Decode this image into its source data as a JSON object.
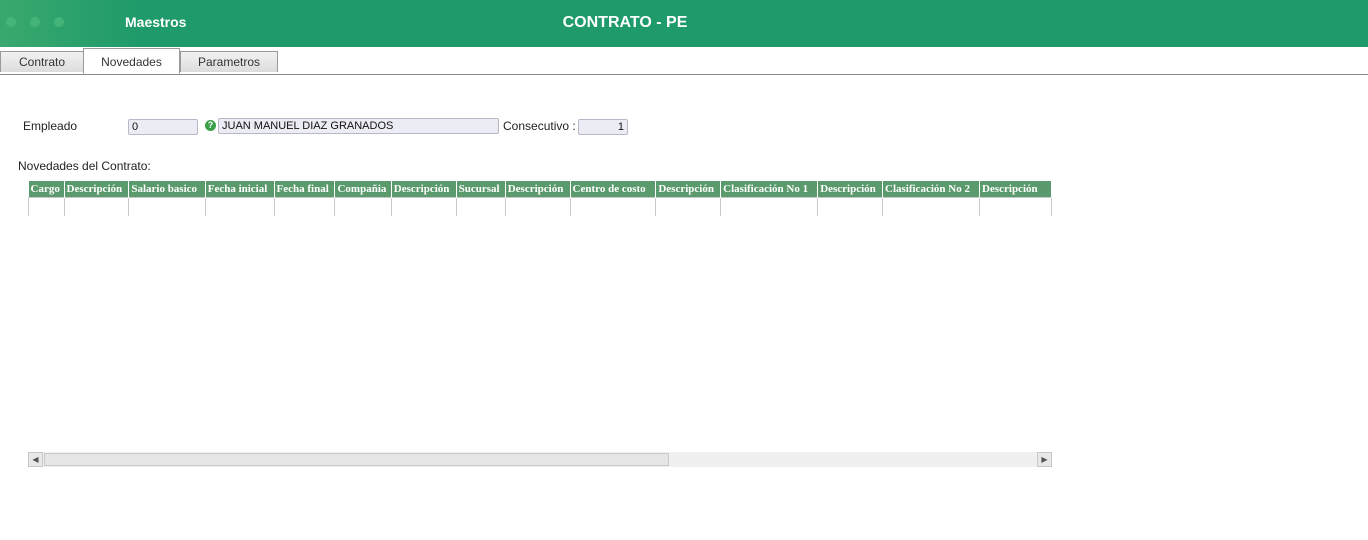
{
  "header": {
    "app_name": "Maestros",
    "title": "CONTRATO - PE"
  },
  "tabs": [
    {
      "label": "Contrato",
      "active": false
    },
    {
      "label": "Novedades",
      "active": true
    },
    {
      "label": "Parametros",
      "active": false
    }
  ],
  "form": {
    "empleado_label": "Empleado",
    "empleado_value": "0",
    "empleado_help": "?",
    "empleado_name": "JUAN MANUEL DIAZ GRANADOS",
    "consecutivo_label": "Consecutivo :",
    "consecutivo_value": "1"
  },
  "grid": {
    "title": "Novedades del Contrato:",
    "columns": [
      "Cargo",
      "Descripción",
      "Salario basico",
      "Fecha inicial",
      "Fecha final",
      "Compañia",
      "Descripción",
      "Sucursal",
      "Descripción",
      "Centro de costo",
      "Descripción",
      "Clasificación No 1",
      "Descripción",
      "Clasificación No 2",
      "Descripción"
    ]
  },
  "scrollbar": {
    "left_arrow": "◀",
    "right_arrow": "▶"
  },
  "colors": {
    "header_bg": "#1f9a6a",
    "grid_header_bg": "#5a9a6c"
  }
}
